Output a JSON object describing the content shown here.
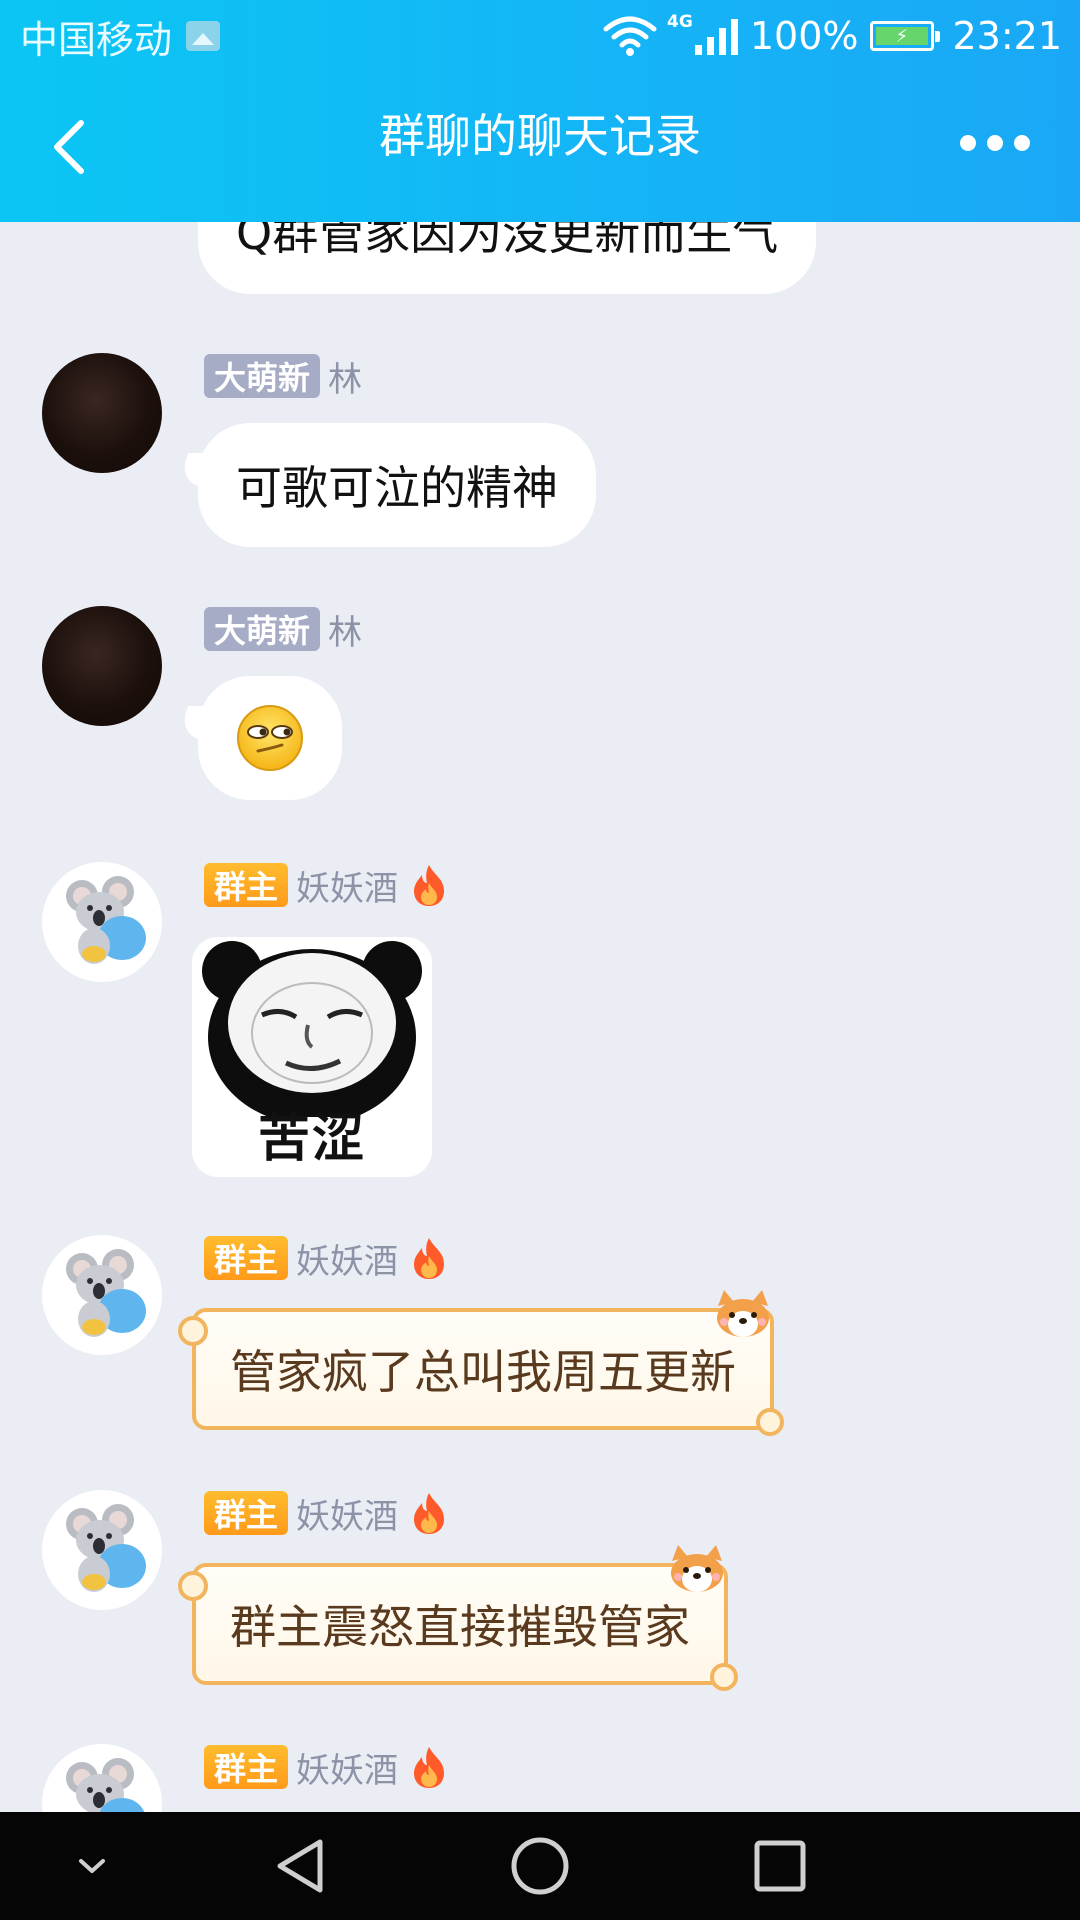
{
  "status_bar": {
    "carrier": "中国移动",
    "network_type": "4G",
    "battery_percent": "100%",
    "time": "23:21"
  },
  "title_bar": {
    "title": "群聊的聊天记录"
  },
  "messages": [
    {
      "text": "Q群管家因为没更新而生气"
    },
    {
      "badge": "大萌新",
      "name": "林",
      "text": "可歌可泣的精神"
    },
    {
      "badge": "大萌新",
      "name": "林",
      "emoji": "smirk-emoji"
    },
    {
      "badge": "群主",
      "name": "妖妖酒",
      "sticker_caption": "苦涩"
    },
    {
      "badge": "群主",
      "name": "妖妖酒",
      "text": "管家疯了总叫我周五更新"
    },
    {
      "badge": "群主",
      "name": "妖妖酒",
      "text": "群主震怒直接摧毁管家"
    },
    {
      "badge": "群主",
      "name": "妖妖酒"
    }
  ],
  "colors": {
    "header_start": "#0bc6f4",
    "header_end": "#1aa8f6",
    "chat_background": "#ebedf5",
    "badge_member": "#a6abc6",
    "badge_owner": "#ff9a1a",
    "scroll_border": "#f3b45e"
  },
  "icons": [
    "gallery-icon",
    "wifi-icon",
    "signal-icon",
    "battery-icon",
    "back-icon",
    "more-icon",
    "fire-icon",
    "koala-avatar",
    "corgi-icon",
    "chevron-down-icon",
    "nav-back-icon",
    "nav-home-icon",
    "nav-recents-icon"
  ]
}
